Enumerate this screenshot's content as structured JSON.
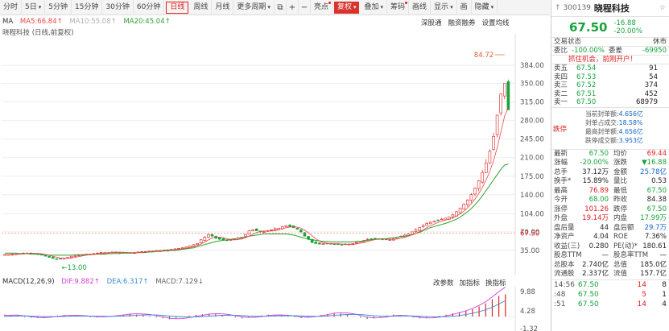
{
  "toolbar": {
    "items": [
      {
        "label": "分时"
      },
      {
        "label": "5日",
        "caret": true
      },
      {
        "label": "5分钟"
      },
      {
        "label": "15分钟"
      },
      {
        "label": "30分钟"
      },
      {
        "label": "60分钟"
      },
      {
        "label": "日线",
        "active": true
      },
      {
        "label": "周线"
      },
      {
        "label": "月线"
      },
      {
        "label": "更多周期",
        "caret": true
      }
    ],
    "icons": [
      "⧉",
      "+",
      "−"
    ],
    "tools": [
      {
        "label": "亮点",
        "dot": true
      },
      {
        "label": "复权",
        "red": true,
        "caret": true
      },
      {
        "label": "叠加",
        "caret": true
      },
      {
        "label": "筹码",
        "dot": true
      },
      {
        "label": "画线"
      },
      {
        "label": "显示",
        "caret": true
      },
      {
        "label": "画"
      },
      {
        "label": "隐藏",
        "caret": true
      }
    ]
  },
  "chart": {
    "indicator_label": "MA",
    "ma5": "MA5:66.84↑",
    "ma10": "MA10:55.08↑",
    "ma20": "MA20:45.04↑",
    "subtitle": "晓程科技 (日线,前复权)",
    "buttons": [
      "深股通",
      "融资融券",
      "设置均线"
    ],
    "macd_name": "MACD(12,26,9)",
    "dif": "DIF:9.882↑",
    "dea": "DEA:6.317↑",
    "macd": "MACD:7.129↓",
    "macd_buttons": [
      "改参数",
      "加指标",
      "换指标"
    ],
    "colors": {
      "up": "#e02020",
      "down": "#17a33b",
      "ma5": "#e84646",
      "ma10": "#b0b0b0",
      "ma20": "#2f9e2f",
      "dif": "#d940d9",
      "dea": "#3a8bd6"
    }
  },
  "chart_data": {
    "type": "candlestick",
    "y_axis": [
      "384.00",
      "350.00",
      "315.00",
      "280.00",
      "245.00",
      "210.00",
      "175.00",
      "140.00",
      "104.00",
      "70.00",
      "35.00"
    ],
    "y_values": [
      384,
      350,
      315,
      280,
      245,
      210,
      175,
      140,
      104,
      70,
      35
    ],
    "high_label": "84.72",
    "low_label": "13.00",
    "current_price_label": "67.50",
    "macd_axis": [
      "9.88",
      "4.28",
      "-1.32"
    ],
    "close_path": [
      27,
      27,
      28,
      28,
      29,
      30,
      30,
      30,
      29,
      28,
      26,
      24,
      22,
      20,
      19,
      19,
      20,
      22,
      24,
      25,
      26,
      27,
      28,
      28,
      29,
      30,
      31,
      31,
      31,
      32,
      32,
      31,
      31,
      30,
      30,
      31,
      32,
      33,
      33,
      33,
      34,
      35,
      35,
      36,
      36,
      37,
      38,
      39,
      40,
      42,
      44,
      46,
      48,
      55,
      60,
      65,
      62,
      58,
      56,
      55,
      54,
      55,
      56,
      58,
      60,
      65,
      72,
      74,
      72,
      70,
      70,
      72,
      74,
      76,
      77,
      80,
      82,
      80,
      78,
      75,
      70,
      62,
      56,
      50,
      48,
      47,
      48,
      48,
      48,
      47,
      46,
      46,
      46,
      47,
      48,
      50,
      52,
      54,
      56,
      57,
      58,
      57,
      56,
      55,
      55,
      57,
      60,
      62,
      64,
      66,
      70,
      74,
      78,
      82,
      86,
      88,
      90,
      92,
      94,
      96,
      98,
      102,
      108,
      115,
      122,
      130,
      140,
      152,
      166,
      182,
      200,
      222,
      250,
      290,
      330,
      350,
      300
    ],
    "ma_path": [
      30,
      30,
      30,
      30,
      29,
      29,
      29,
      28,
      28,
      28,
      27,
      27,
      26,
      26,
      26,
      26,
      26,
      26,
      26,
      27,
      27,
      27,
      27,
      27,
      28,
      28,
      28,
      28,
      29,
      29,
      29,
      29,
      30,
      30,
      30,
      30,
      31,
      31,
      31,
      32,
      32,
      33,
      33,
      34,
      34,
      35,
      35,
      36,
      37,
      38,
      39,
      40,
      42,
      44,
      46,
      48,
      50,
      52,
      53,
      54,
      55,
      56,
      57,
      58,
      59,
      60,
      62,
      63,
      64,
      65,
      66,
      66,
      66,
      66,
      66,
      66,
      66,
      65,
      64,
      62,
      60,
      58,
      56,
      55,
      54,
      53,
      52,
      52,
      51,
      51,
      51,
      51,
      51,
      51,
      51,
      52,
      52,
      53,
      54,
      55,
      56,
      56,
      57,
      57,
      58,
      59,
      60,
      61,
      62,
      63,
      65,
      67,
      69,
      72,
      75,
      78,
      80,
      82,
      84,
      86,
      88,
      91,
      94,
      98,
      103,
      108,
      114,
      121,
      129,
      138,
      148,
      158,
      168,
      178,
      188,
      196,
      198
    ],
    "macd_bars": [
      0.6,
      0.4,
      0.3,
      -0.2,
      -0.4,
      -0.5,
      -0.3,
      0.1,
      0.3,
      0.5,
      0.3,
      0.2,
      0.1,
      -0.2,
      -0.3,
      -0.1,
      0.2,
      0.4,
      0.6,
      0.8,
      0.6,
      0.4,
      0.2,
      -0.3,
      -0.6,
      -0.9,
      -0.6,
      -0.3,
      0.2,
      0.5,
      0.7,
      0.9,
      0.7,
      0.4,
      0.1,
      -0.3,
      -0.6,
      -0.4,
      -0.1,
      0.3,
      0.6,
      0.5,
      0.3,
      0.1,
      -0.2,
      -0.5,
      -0.3,
      0.2,
      0.5,
      0.8,
      1.2,
      0.9,
      0.5,
      0.1,
      -0.4,
      -0.8,
      -0.6,
      -0.2,
      0.3,
      0.6,
      0.4,
      0.1,
      -0.3,
      -0.6,
      -0.5,
      -0.2,
      0.2,
      0.6,
      1.0,
      1.4,
      1.8,
      2.4,
      3.2,
      4.2,
      5.5,
      6.6,
      7.1
    ]
  },
  "panel": {
    "code": "300139",
    "name": "晓程科技",
    "arrow": "↑",
    "star": "☆",
    "price": "67.50",
    "change": "-16.88",
    "change_pct": "-20.00%",
    "trade_status_label": "交易状态",
    "trade_status": "休市",
    "wei_bi_label": "委比",
    "wei_bi": "-100.00%",
    "wei_cha_label": "委差",
    "wei_cha": "-69950",
    "promo": "抓住机会，前刚开户！",
    "book": [
      {
        "label": "卖五",
        "price": "67.54",
        "vol": "91"
      },
      {
        "label": "卖四",
        "price": "67.53",
        "vol": "54"
      },
      {
        "label": "卖三",
        "price": "67.52",
        "vol": "374"
      },
      {
        "label": "卖二",
        "price": "67.51",
        "vol": "452"
      },
      {
        "label": "卖一",
        "price": "67.50",
        "vol": "68979"
      }
    ],
    "limit_stamp": "跌停",
    "seal": [
      {
        "k": "当前封单额:",
        "v": "4.656亿"
      },
      {
        "k": "封单占成交:",
        "v": "18.58%"
      },
      {
        "k": "最高封单额:",
        "v": "4.656亿"
      },
      {
        "k": "跌停成交额:",
        "v": "3.953亿"
      }
    ],
    "stats": [
      {
        "a": "最新",
        "v": "67.50",
        "vc": "g",
        "c": "均价",
        "d": "69.44",
        "dc": "r"
      },
      {
        "a": "涨幅",
        "v": "-20.00%",
        "vc": "g",
        "c": "涨跌",
        "d": "▼16.88",
        "dc": "g"
      },
      {
        "a": "总手",
        "v": "37.12万",
        "vc": "k",
        "c": "金额",
        "d": "25.78亿",
        "dc": "b"
      },
      {
        "a": "换手*",
        "v": "15.89%",
        "vc": "k",
        "c": "量比",
        "d": "0.53",
        "dc": "k"
      },
      {
        "a": "最高",
        "v": "76.89",
        "vc": "r",
        "c": "最低",
        "d": "67.50",
        "dc": "g"
      },
      {
        "a": "今开",
        "v": "68.00",
        "vc": "g",
        "c": "昨收",
        "d": "84.38",
        "dc": "k"
      },
      {
        "a": "涨停",
        "v": "101.26",
        "vc": "r",
        "c": "跌停",
        "d": "67.50",
        "dc": "g"
      },
      {
        "a": "外盘",
        "v": "19.14万",
        "vc": "r",
        "c": "内盘",
        "d": "17.99万",
        "dc": "g"
      },
      {
        "a": "盘后量",
        "v": "44",
        "vc": "k",
        "c": "盘后额",
        "d": "29.7万",
        "dc": "b"
      },
      {
        "a": "净资产",
        "v": "4.04",
        "vc": "k",
        "c": "ROE",
        "d": "7.36%",
        "dc": "k"
      },
      {
        "a": "收益(三)",
        "v": "0.280",
        "vc": "k",
        "c": "PE(动)*",
        "d": "180.61",
        "dc": "k"
      },
      {
        "a": "股息TTM",
        "v": "—",
        "vc": "k",
        "c": "股息率TTM",
        "d": "—",
        "dc": "k"
      },
      {
        "a": "总股本",
        "v": "2.740亿",
        "vc": "k",
        "c": "总值",
        "d": "185.0亿",
        "dc": "k"
      },
      {
        "a": "流通股",
        "v": "2.337亿",
        "vc": "k",
        "c": "流值",
        "d": "157.7亿",
        "dc": "k"
      }
    ],
    "ticks": [
      {
        "t": "14:56",
        "p": "67.50",
        "v": "14",
        "n": "8"
      },
      {
        "t": ":48",
        "p": "67.50",
        "v": "5",
        "n": "1"
      },
      {
        "t": ":51",
        "p": "67.50",
        "v": "14",
        "n": "4"
      }
    ]
  }
}
